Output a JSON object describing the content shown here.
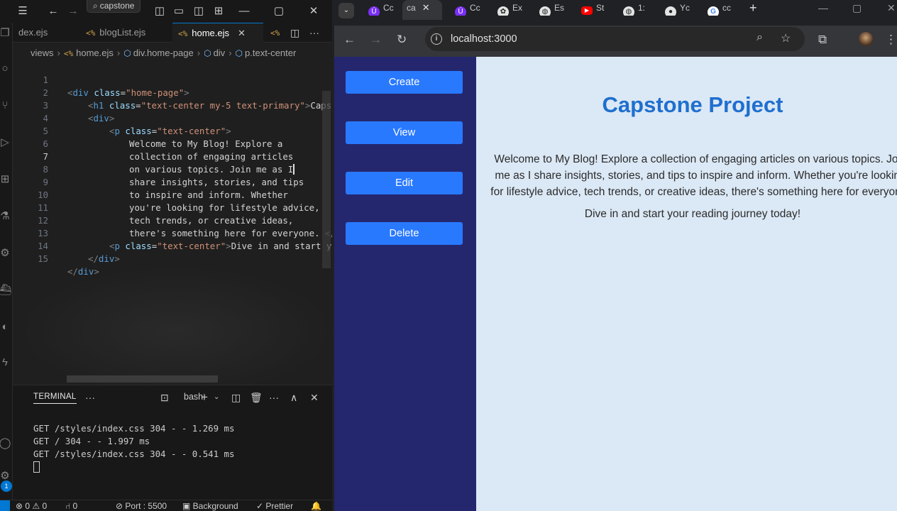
{
  "vscode": {
    "search_text": "capstone",
    "tabs": [
      {
        "label": "dex.ejs",
        "active": false
      },
      {
        "label": "blogList.ejs",
        "active": false
      },
      {
        "label": "home.ejs",
        "active": true
      }
    ],
    "ejs_glyph": "<%",
    "breadcrumb": [
      "views",
      "home.ejs",
      "div.home-page",
      "div",
      "p.text-center"
    ],
    "code_lines": [
      {
        "n": "1"
      },
      {
        "n": "2"
      },
      {
        "n": "3"
      },
      {
        "n": "4"
      },
      {
        "n": "5"
      },
      {
        "n": "6"
      },
      {
        "n": "7"
      },
      {
        "n": "8"
      },
      {
        "n": "9"
      },
      {
        "n": "10"
      },
      {
        "n": "11"
      },
      {
        "n": "12"
      },
      {
        "n": "13"
      },
      {
        "n": "14"
      },
      {
        "n": "15"
      }
    ],
    "code": {
      "l1_class": "\"home-page\"",
      "l2_class": "\"text-center my-5 text-primary\"",
      "l2_text": "Capst",
      "l4_class": "\"text-center\"",
      "l5": "Welcome to My Blog! Explore a",
      "l6": "collection of engaging articles",
      "l7": "on various topics. Join me as I",
      "l8": "share insights, stories, and tips",
      "l9": "to inspire and inform. Whether",
      "l10": "you're looking for lifestyle advice,",
      "l11": "tech trends, or creative ideas,",
      "l12": "there's something here for everyone.",
      "l13_class": "\"text-center\"",
      "l13_text": "Dive in and start yo"
    },
    "panel": {
      "title": "TERMINAL",
      "shell": "bash",
      "lines": [
        "GET /styles/index.css 304 - - 1.269 ms",
        "GET / 304 - - 1.997 ms",
        "GET /styles/index.css 304 - - 0.541 ms"
      ]
    },
    "status": {
      "errors": "0",
      "warnings": "0",
      "ports": "0",
      "port": "Port : 5500",
      "background": "Background",
      "prettier": "Prettier",
      "badge": "1"
    }
  },
  "chrome": {
    "tabs": [
      {
        "label": "Cc"
      },
      {
        "label": "ca"
      },
      {
        "label": "Cc"
      },
      {
        "label": "Ex"
      },
      {
        "label": "Es"
      },
      {
        "label": "St"
      },
      {
        "label": "1:"
      },
      {
        "label": "Yc"
      },
      {
        "label": "cc"
      }
    ],
    "url": "localhost:3000",
    "page": {
      "nav_buttons": [
        "Create",
        "View",
        "Edit",
        "Delete"
      ],
      "title": "Capstone Project",
      "intro": "Welcome to My Blog! Explore a collection of engaging articles on various topics. Join me as I share insights, stories, and tips to inspire and inform. Whether you're looking for lifestyle advice, tech trends, or creative ideas, there's something here for everyone.",
      "outro": "Dive in and start your reading journey today!"
    },
    "colors": {
      "sidebar": "#24276e",
      "button": "#2979ff",
      "title": "#1f6fcf",
      "background": "#dbe8f5"
    }
  }
}
